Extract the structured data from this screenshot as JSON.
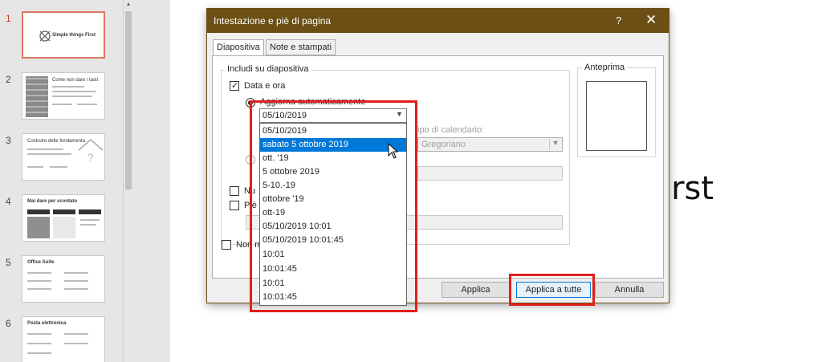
{
  "thumbnails": [
    {
      "num": "1",
      "title": "Simple things First",
      "selected": true
    },
    {
      "num": "2",
      "title": "Come non dare i tasti",
      "selected": false
    },
    {
      "num": "3",
      "title": "Costruire delle fondamenta",
      "selected": false
    },
    {
      "num": "4",
      "title": "Mai dare per scontato",
      "selected": false
    },
    {
      "num": "5",
      "title": "Office Suite",
      "selected": false
    },
    {
      "num": "6",
      "title": "Posta elettronica",
      "selected": false
    }
  ],
  "slide": {
    "visible_title": "irst"
  },
  "dialog": {
    "title": "Intestazione e piè di pagina",
    "help_label": "?",
    "close_label": "✕",
    "tabs": [
      "Diapositiva",
      "Note e stampati"
    ],
    "group_label": "Includi su diapositiva",
    "date_time_label": "Data e ora",
    "auto_update_label": "Aggiorna automaticamente",
    "calendar_label": "ipo di calendario:",
    "calendar_value": "Gregoriano",
    "slide_number_label": "Nu",
    "footer_label": "Piè d",
    "not_title_label": "Non m",
    "preview_label": "Anteprima",
    "buttons": {
      "apply": "Applica",
      "apply_all": "Applica a tutte",
      "cancel": "Annulla"
    }
  },
  "date_dropdown": {
    "selected_value": "05/10/2019",
    "highlighted_index": 1,
    "options": [
      "05/10/2019",
      "sabato 5 ottobre 2019",
      "ott. '19",
      "5 ottobre 2019",
      "5-10.-19",
      "ottobre '19",
      "ott-19",
      "05/10/2019 10:01",
      "05/10/2019 10:01:45",
      "10:01",
      "10:01:45",
      "10:01",
      "10:01:45"
    ]
  },
  "colors": {
    "titlebar": "#6b4f14",
    "highlight": "#0078d7",
    "annotation": "#e0201a",
    "selected_thumb": "#e07860"
  }
}
